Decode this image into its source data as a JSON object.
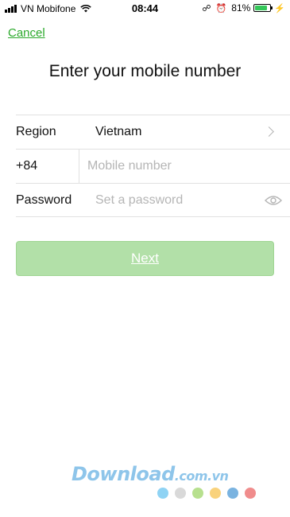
{
  "status_bar": {
    "carrier": "VN Mobifone",
    "time": "08:44",
    "battery_percent": "81%",
    "battery_level": 0.81,
    "battery_color": "#34c759"
  },
  "nav": {
    "cancel_label": "Cancel"
  },
  "title": "Enter your mobile number",
  "form": {
    "region_label": "Region",
    "region_value": "Vietnam",
    "country_code": "+84",
    "mobile_placeholder": "Mobile number",
    "mobile_value": "",
    "password_label": "Password",
    "password_placeholder": "Set a password",
    "password_value": ""
  },
  "next_label": "Next",
  "colors": {
    "accent": "#2ba92b",
    "button_bg": "#b2e0a8"
  },
  "watermark": {
    "brand": "Download",
    "domain": ".com.vn",
    "dot_colors": [
      "#8fd3f4",
      "#d9d9d9",
      "#b7e08e",
      "#f9d27c",
      "#7ab3e0",
      "#f08c8c"
    ]
  }
}
